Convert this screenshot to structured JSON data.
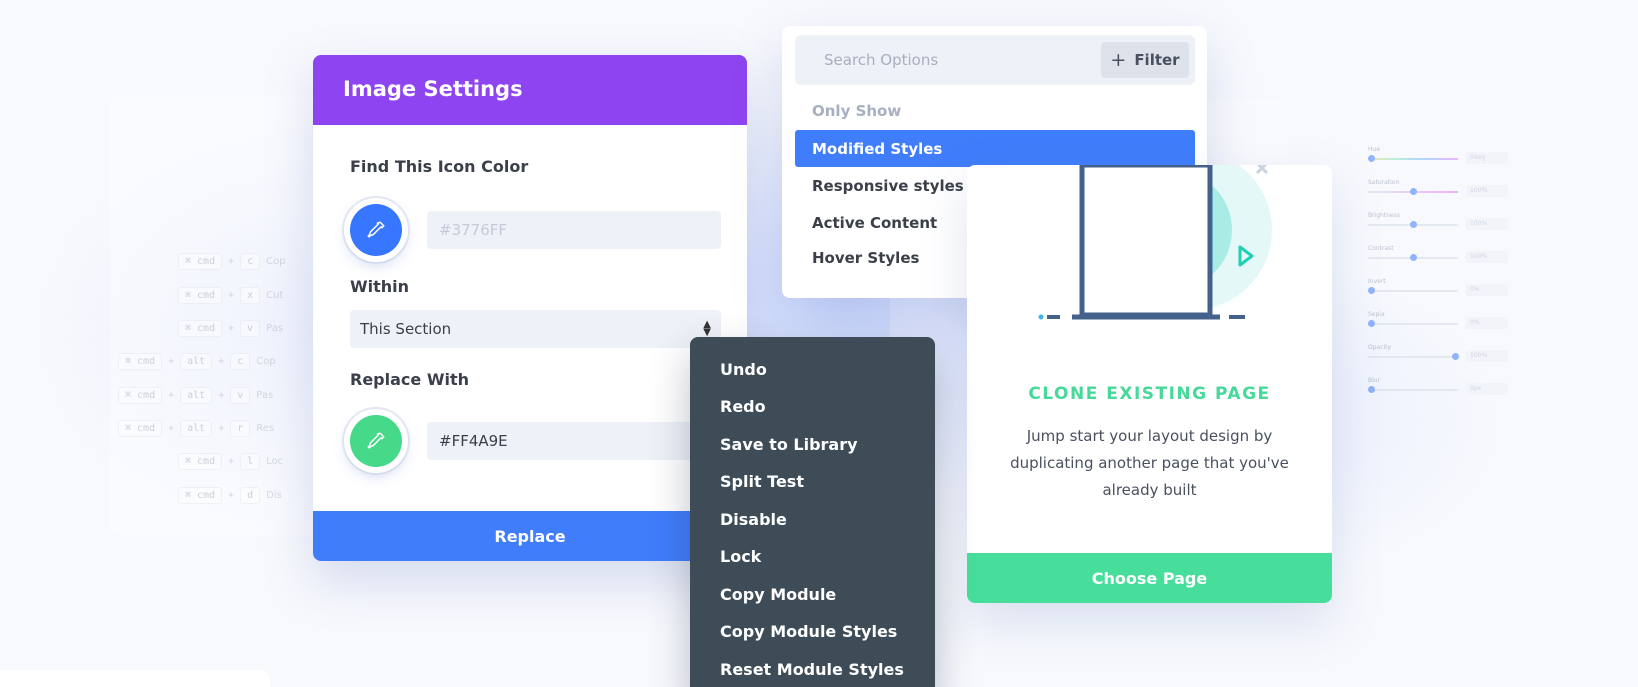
{
  "shortcuts": [
    {
      "keys": [
        "⌘ cmd",
        "c"
      ],
      "label": "Cop"
    },
    {
      "keys": [
        "⌘ cmd",
        "x"
      ],
      "label": "Cut"
    },
    {
      "keys": [
        "⌘ cmd",
        "v"
      ],
      "label": "Pas"
    },
    {
      "keys": [
        "⌘ cmd",
        "alt",
        "c"
      ],
      "label": "Cop"
    },
    {
      "keys": [
        "⌘ cmd",
        "alt",
        "v"
      ],
      "label": "Pas"
    },
    {
      "keys": [
        "⌘ cmd",
        "alt",
        "r"
      ],
      "label": "Res"
    },
    {
      "keys": [
        "⌘ cmd",
        "l"
      ],
      "label": "Loc"
    },
    {
      "keys": [
        "⌘ cmd",
        "d"
      ],
      "label": "Dis"
    }
  ],
  "image_settings": {
    "title": "Image Settings",
    "find_label": "Find This Icon Color",
    "find_color_placeholder": "#3776FF",
    "find_color_accent": "#3776FF",
    "within_label": "Within",
    "within_value": "This Section",
    "replace_label": "Replace With",
    "replace_color_value": "#FF4A9E",
    "replace_color_accent": "#46D98A",
    "replace_button": "Replace"
  },
  "options": {
    "search_placeholder": "Search Options",
    "filter_label": "Filter",
    "only_show_label": "Only Show",
    "items": [
      "Modified Styles",
      "Responsive styles",
      "Active Content",
      "Hover Styles"
    ],
    "active_index": 0
  },
  "context_menu": {
    "items": [
      "Undo",
      "Redo",
      "Save to Library",
      "Split Test",
      "Disable",
      "Lock",
      "Copy Module",
      "Copy Module Styles",
      "Reset Module Styles"
    ]
  },
  "clone": {
    "title": "CLONE EXISTING PAGE",
    "description": "Jump start your layout design by duplicating another page that you've already built",
    "button": "Choose Page"
  },
  "sliders": [
    {
      "label": "Hue",
      "value": "0deg",
      "level": 0.03
    },
    {
      "label": "Saturation",
      "value": "100%",
      "level": 0.5
    },
    {
      "label": "Brightness",
      "value": "100%",
      "level": 0.5
    },
    {
      "label": "Contrast",
      "value": "100%",
      "level": 0.5
    },
    {
      "label": "Invert",
      "value": "0%",
      "level": 0.03
    },
    {
      "label": "Sepia",
      "value": "0%",
      "level": 0.03
    },
    {
      "label": "Opacity",
      "value": "100%",
      "level": 0.97
    },
    {
      "label": "Blur",
      "value": "0px",
      "level": 0.03
    }
  ],
  "colors": {
    "purple": "#8E44F0",
    "blue": "#3F7DFB",
    "green": "#47DE9C",
    "dark": "#3E4C57"
  }
}
